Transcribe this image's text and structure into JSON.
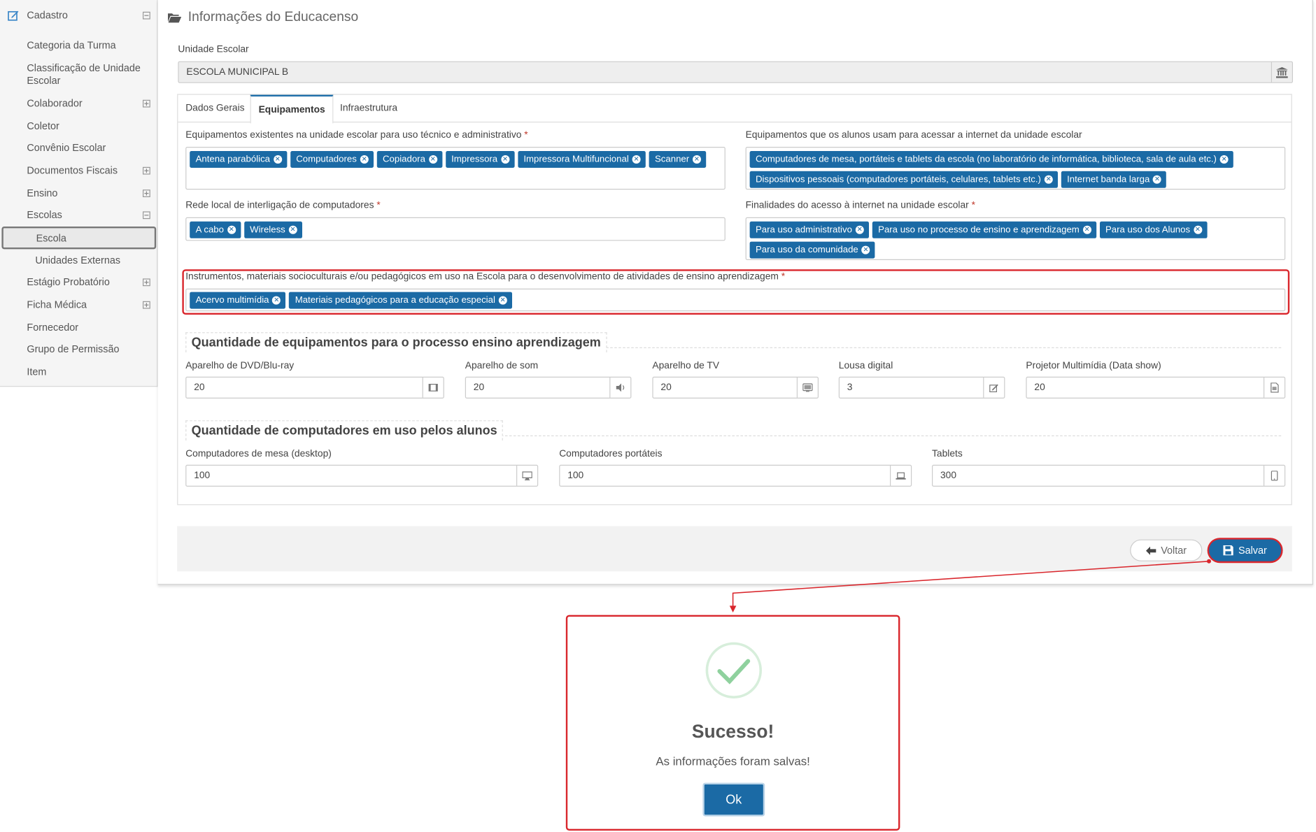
{
  "sidebar": {
    "header": "Cadastro",
    "items": [
      {
        "label": "Categoria da Turma"
      },
      {
        "label": "Classificação de Unidade Escolar"
      },
      {
        "label": "Colaborador"
      },
      {
        "label": "Coletor"
      },
      {
        "label": "Convênio Escolar"
      },
      {
        "label": "Documentos Fiscais"
      },
      {
        "label": "Ensino"
      },
      {
        "label": "Escolas"
      },
      {
        "label": "Escola"
      },
      {
        "label": "Unidades Externas"
      },
      {
        "label": "Estágio Probatório"
      },
      {
        "label": "Ficha Médica"
      },
      {
        "label": "Fornecedor"
      },
      {
        "label": "Grupo de Permissão"
      },
      {
        "label": "Item"
      }
    ]
  },
  "page": {
    "title": "Informações do Educacenso",
    "unidade_label": "Unidade Escolar",
    "unidade_value": "ESCOLA MUNICIPAL B"
  },
  "tabs": [
    "Dados Gerais",
    "Equipamentos",
    "Infraestrutura"
  ],
  "equipamentos": {
    "admin_label": "Equipamentos existentes na unidade escolar para uso técnico e administrativo",
    "admin_tags": [
      "Antena parabólica",
      "Computadores",
      "Copiadora",
      "Impressora",
      "Impressora Multifuncional",
      "Scanner"
    ],
    "alunos_label": "Equipamentos que os alunos usam para acessar a internet da unidade escolar",
    "alunos_tags": [
      "Computadores de mesa, portáteis e tablets da escola (no laboratório de informática, biblioteca, sala de aula etc.)",
      "Dispositivos pessoais (computadores portáteis, celulares, tablets etc.)",
      "Internet banda larga"
    ],
    "rede_label": "Rede local de interligação de computadores",
    "rede_tags": [
      "A cabo",
      "Wireless"
    ],
    "finalidades_label": "Finalidades do acesso à internet na unidade escolar",
    "finalidades_tags": [
      "Para uso administrativo",
      "Para uso no processo de ensino e aprendizagem",
      "Para uso dos Alunos",
      "Para uso da comunidade"
    ],
    "instrumentos_label": "Instrumentos, materiais socioculturais e/ou pedagógicos em uso na Escola para o desenvolvimento de atividades de ensino aprendizagem",
    "instrumentos_tags": [
      "Acervo multimídia",
      "Materiais pedagógicos para a educação especial"
    ],
    "required_mark": "*"
  },
  "qtd_equip": {
    "title": "Quantidade de equipamentos para o processo ensino aprendizagem",
    "fields": [
      {
        "label": "Aparelho de DVD/Blu-ray",
        "value": "20",
        "icon": "film-icon"
      },
      {
        "label": "Aparelho de som",
        "value": "20",
        "icon": "volume-icon"
      },
      {
        "label": "Aparelho de TV",
        "value": "20",
        "icon": "tv-icon"
      },
      {
        "label": "Lousa digital",
        "value": "3",
        "icon": "edit-icon"
      },
      {
        "label": "Projetor Multimídia (Data show)",
        "value": "20",
        "icon": "file-icon"
      }
    ]
  },
  "qtd_comp": {
    "title": "Quantidade de computadores em uso pelos alunos",
    "fields": [
      {
        "label": "Computadores de mesa (desktop)",
        "value": "100",
        "icon": "desktop-icon"
      },
      {
        "label": "Computadores portáteis",
        "value": "100",
        "icon": "laptop-icon"
      },
      {
        "label": "Tablets",
        "value": "300",
        "icon": "tablet-icon"
      }
    ]
  },
  "buttons": {
    "voltar": "Voltar",
    "salvar": "Salvar"
  },
  "modal": {
    "title": "Sucesso!",
    "message": "As informações foram salvas!",
    "ok": "Ok"
  },
  "colors": {
    "primary": "#1b6aa5",
    "highlight": "#d9262c",
    "success": "#8fd19e"
  }
}
